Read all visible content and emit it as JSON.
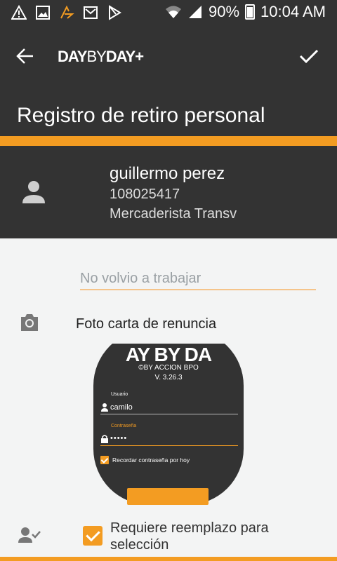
{
  "status_bar": {
    "battery": "90%",
    "time": "10:04 AM",
    "icons": [
      "warning-icon",
      "image-icon",
      "app-icon",
      "gmail-icon",
      "play-store-icon",
      "wifi-icon",
      "signal-icon",
      "battery-icon"
    ]
  },
  "app_bar": {
    "logo_bold1": "DAY",
    "logo_light": "BY",
    "logo_bold2": "DAY+",
    "title": "Registro de retiro personal"
  },
  "profile": {
    "name": "guillermo perez",
    "document": "108025417",
    "role": "Mercaderista Transv"
  },
  "form": {
    "reason_value": "No volvio a trabajar",
    "photo_label": "Foto carta de renuncia",
    "replacement_label": "Requiere reemplazo para selección",
    "replacement_checked": true
  },
  "photo_preview": {
    "brand": "AY BY DA",
    "by_line": "©BY ACCION BPO",
    "version": "V. 3.26.3",
    "user_label": "Usuario",
    "user_value": "camilo",
    "password_label": "Contraseña",
    "password_value": "•••••",
    "remember_label": "Recordar contraseña por hoy"
  },
  "colors": {
    "accent": "#f39c22",
    "dark": "#333333",
    "background": "#f3f4f4"
  }
}
